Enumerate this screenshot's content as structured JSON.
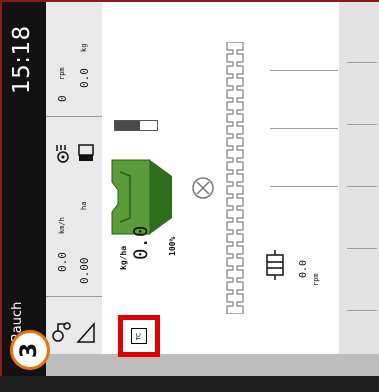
{
  "status_bar": {
    "clock": "15:18",
    "brand": "Rauch"
  },
  "info_panel": {
    "engine_speed": {
      "value": "0",
      "unit": "rpm"
    },
    "hopper_weight": {
      "value": "0.0",
      "unit": "kg"
    },
    "forward_speed": {
      "value": "0.0",
      "unit": "km/h"
    },
    "area_worked": {
      "value": "0.00",
      "unit": "ha"
    },
    "bottom_icons": [
      "tractor-icon",
      "slope-icon"
    ]
  },
  "spreader": {
    "hopper_fill_percent": 60,
    "application_rate": {
      "unit": "kg/ha",
      "value": "0.0",
      "percent": "100%"
    },
    "icons": [
      "hopper-icon",
      "shutoff-icon",
      "section-bar-icon"
    ]
  },
  "pto": {
    "value": "0.0",
    "unit": "rpm"
  },
  "task_controller": {
    "label": "TC"
  },
  "step_badge": {
    "number": "3"
  },
  "colors": {
    "hopper_green": "#5a9c3a",
    "hopper_dark": "#2c6e1a",
    "highlight": "#e00000",
    "badge_orange": "#e8750c"
  }
}
